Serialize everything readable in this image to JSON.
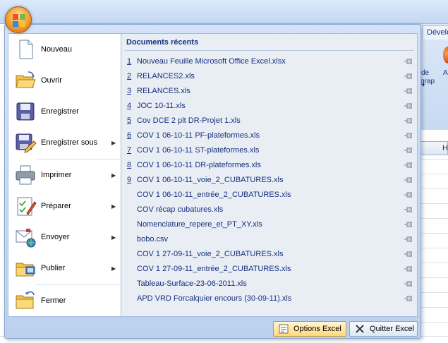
{
  "ribbon": {
    "tab_label": "Dévelo",
    "text1": "de",
    "text2": "A",
    "text3": "grap",
    "column_header": "H"
  },
  "menu": {
    "items": [
      {
        "label": "Nouveau",
        "has_submenu": false,
        "icon": "new-document-icon"
      },
      {
        "label": "Ouvrir",
        "has_submenu": false,
        "icon": "open-folder-icon"
      },
      {
        "label": "Enregistrer",
        "has_submenu": false,
        "icon": "save-icon"
      },
      {
        "label": "Enregistrer sous",
        "has_submenu": true,
        "icon": "save-as-icon"
      },
      {
        "label": "Imprimer",
        "has_submenu": true,
        "icon": "printer-icon"
      },
      {
        "label": "Préparer",
        "has_submenu": true,
        "icon": "prepare-icon"
      },
      {
        "label": "Envoyer",
        "has_submenu": true,
        "icon": "send-icon"
      },
      {
        "label": "Publier",
        "has_submenu": true,
        "icon": "publish-icon"
      },
      {
        "label": "Fermer",
        "has_submenu": false,
        "icon": "close-folder-icon"
      }
    ]
  },
  "recent": {
    "title": "Documents récents",
    "documents": [
      {
        "num": "1",
        "name": "Nouveau Feuille Microsoft Office Excel.xlsx"
      },
      {
        "num": "2",
        "name": "RELANCES2.xls"
      },
      {
        "num": "3",
        "name": "RELANCES.xls"
      },
      {
        "num": "4",
        "name": "JOC 10-11.xls"
      },
      {
        "num": "5",
        "name": "Cov DCE 2 plt  DR-Projet 1.xls"
      },
      {
        "num": "6",
        "name": "COV 1     06-10-11 PF-plateformes.xls"
      },
      {
        "num": "7",
        "name": "COV 1     06-10-11 ST-plateformes.xls"
      },
      {
        "num": "8",
        "name": "COV 1     06-10-11 DR-plateformes.xls"
      },
      {
        "num": "9",
        "name": "COV 1     06-10-11_voie_2_CUBATURES.xls"
      },
      {
        "num": "",
        "name": "COV 1     06-10-11_entrée_2_CUBATURES.xls"
      },
      {
        "num": "",
        "name": "COV récap cubatures.xls"
      },
      {
        "num": "",
        "name": "Nomenclature_repere_et_PT_XY.xls"
      },
      {
        "num": "",
        "name": "bobo.csv"
      },
      {
        "num": "",
        "name": "COV 1     27-09-11_voie_2_CUBATURES.xls"
      },
      {
        "num": "",
        "name": "COV 1     27-09-11_entrée_2_CUBATURES.xls"
      },
      {
        "num": "",
        "name": "Tableau-Surface-23-06-2011.xls"
      },
      {
        "num": "",
        "name": "APD VRD Forcalquier encours (30-09-11).xls"
      }
    ]
  },
  "buttons": {
    "options": "Options Excel",
    "quit": "Quitter Excel"
  }
}
